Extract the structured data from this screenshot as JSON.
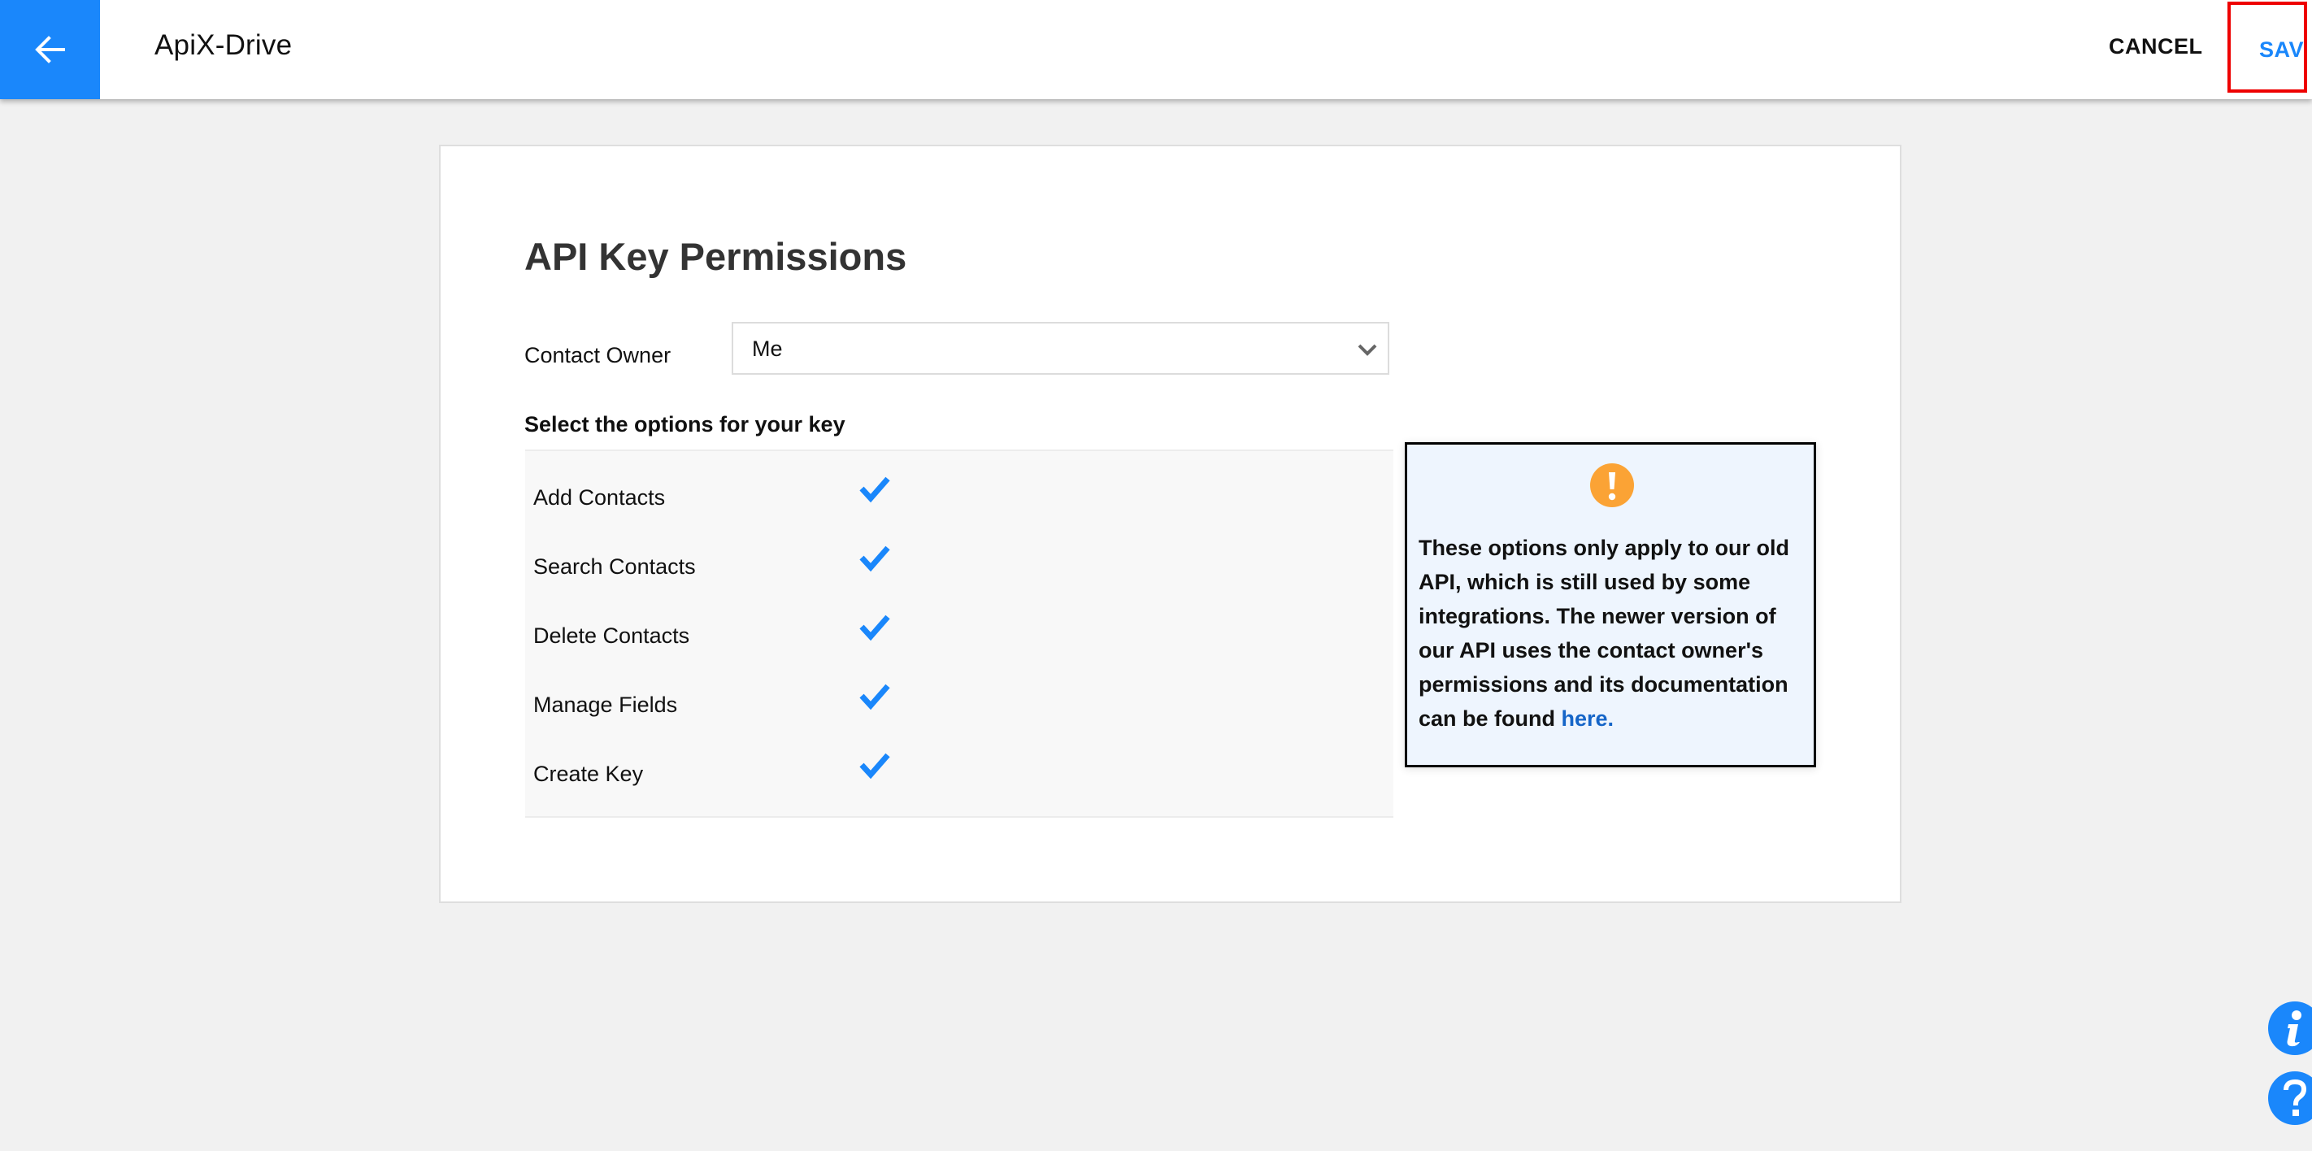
{
  "header": {
    "back_icon": "arrow-left-icon",
    "app_title": "ApiX-Drive",
    "cancel_label": "CANCEL",
    "save_label": "SAVE"
  },
  "page": {
    "title": "API Key Permissions",
    "contact_owner": {
      "label": "Contact Owner",
      "selected": "Me",
      "icon": "chevron-down-icon"
    },
    "options_heading": "Select the options for your key",
    "options": [
      {
        "label": "Add Contacts",
        "checked": true
      },
      {
        "label": "Search Contacts",
        "checked": true
      },
      {
        "label": "Delete Contacts",
        "checked": true
      },
      {
        "label": "Manage Fields",
        "checked": true
      },
      {
        "label": "Create Key",
        "checked": true
      }
    ],
    "notice": {
      "icon": "warning-exclamation-icon",
      "text": "These options only apply to our old API, which is still used by some integrations. The newer version of our API uses the contact owner's permissions and its documentation can be found ",
      "link_text": "here."
    }
  },
  "floating": {
    "info_icon": "info-icon",
    "help_icon": "help-question-icon"
  },
  "colors": {
    "accent": "#1a87fb",
    "warning": "#fba335",
    "link": "#1565c8",
    "highlight_box": "#ee0000",
    "notice_bg": "#eef5fe"
  }
}
